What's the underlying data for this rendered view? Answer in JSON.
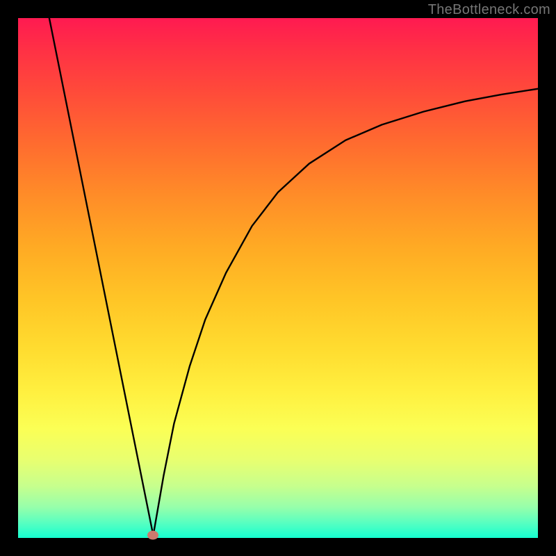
{
  "watermark": "TheBottleneck.com",
  "chart_data": {
    "type": "line",
    "title": "",
    "xlabel": "",
    "ylabel": "",
    "xlim": [
      0,
      100
    ],
    "ylim": [
      0,
      100
    ],
    "grid": false,
    "legend": false,
    "series": [
      {
        "name": "left-descending-line",
        "x": [
          6.0,
          26.0
        ],
        "y": [
          100.0,
          0.5
        ]
      },
      {
        "name": "right-log-curve",
        "x": [
          26.0,
          28.0,
          30.0,
          33.0,
          36.0,
          40.0,
          45.0,
          50.0,
          56.0,
          63.0,
          70.0,
          78.0,
          86.0,
          93.0,
          100.0
        ],
        "y": [
          0.5,
          12.0,
          22.0,
          33.0,
          42.0,
          51.0,
          60.0,
          66.5,
          72.0,
          76.5,
          79.5,
          82.0,
          84.0,
          85.3,
          86.4
        ]
      }
    ],
    "marker": {
      "x": 26.0,
      "y": 0.5,
      "color": "#cc7a6e"
    },
    "background_gradient": {
      "top": "#ff1a51",
      "bottom": "#15ffd0",
      "description": "vertical red-orange-yellow-green gradient"
    },
    "frame": {
      "border_color": "#000000",
      "border_width_px": 26
    }
  }
}
